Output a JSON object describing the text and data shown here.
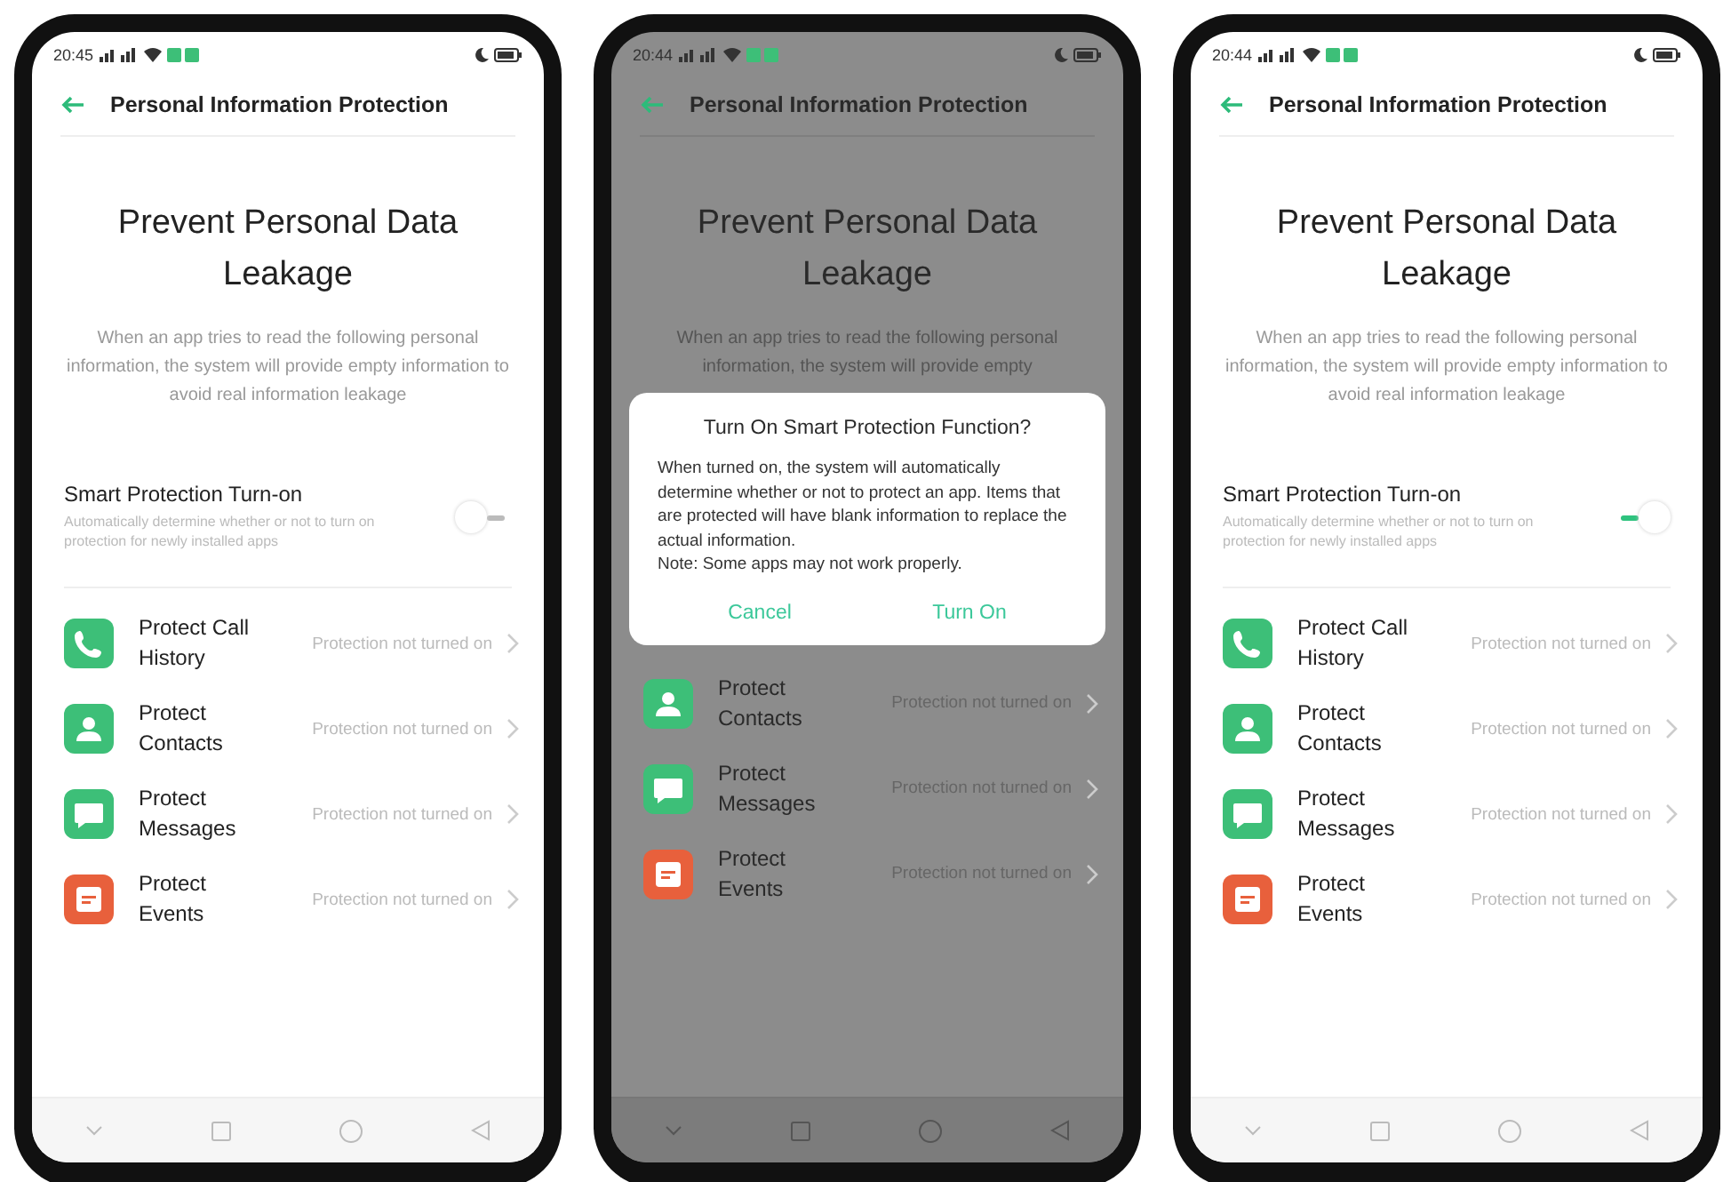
{
  "phones": [
    {
      "status": {
        "time": "20:45"
      },
      "header": {
        "title": "Personal Information Protection"
      },
      "heading": "Prevent Personal Data Leakage",
      "description": "When an app tries to read the following personal information, the system will provide empty information to avoid real information leakage",
      "smart": {
        "title": "Smart Protection Turn-on",
        "subtitle": "Automatically determine whether or not to turn on protection for newly installed apps",
        "on": false
      },
      "rows": [
        {
          "kind": "call",
          "title": "Protect Call History",
          "status": "Protection not turned on",
          "color": "#3dbf78"
        },
        {
          "kind": "contacts",
          "title": "Protect Contacts",
          "status": "Protection not turned on",
          "color": "#3dbf78"
        },
        {
          "kind": "messages",
          "title": "Protect Messages",
          "status": "Protection not turned on",
          "color": "#3dbf78"
        },
        {
          "kind": "events",
          "title": "Protect Events",
          "status": "Protection not turned on",
          "color": "#e8603c"
        }
      ]
    },
    {
      "status": {
        "time": "20:44"
      },
      "header": {
        "title": "Personal Information Protection"
      },
      "heading": "Prevent Personal Data Leakage",
      "description": "When an app tries to read the following personal information, the system will provide empty",
      "dialog": {
        "title": "Turn On Smart Protection Function?",
        "body": [
          "When turned on, the system will automatically determine whether or not to protect an app. Items that are protected will have blank information to replace the actual information.",
          "Note: Some apps may not work properly."
        ],
        "buttons": [
          "Cancel",
          "Turn On"
        ]
      },
      "rows": [
        {
          "kind": "contacts",
          "title": "Protect Contacts",
          "status": "Protection not turned on",
          "color": "#3dbf78"
        },
        {
          "kind": "messages",
          "title": "Protect Messages",
          "status": "Protection not turned on",
          "color": "#3dbf78"
        },
        {
          "kind": "events",
          "title": "Protect Events",
          "status": "Protection not turned on",
          "color": "#e8603c"
        }
      ]
    },
    {
      "status": {
        "time": "20:44"
      },
      "header": {
        "title": "Personal Information Protection"
      },
      "heading": "Prevent Personal Data Leakage",
      "description": "When an app tries to read the following personal information, the system will provide empty information to avoid real information leakage",
      "smart": {
        "title": "Smart Protection Turn-on",
        "subtitle": "Automatically determine whether or not to turn on protection for newly installed apps",
        "on": true
      },
      "rows": [
        {
          "kind": "call",
          "title": "Protect Call History",
          "status": "Protection not turned on",
          "color": "#3dbf78"
        },
        {
          "kind": "contacts",
          "title": "Protect Contacts",
          "status": "Protection not turned on",
          "color": "#3dbf78"
        },
        {
          "kind": "messages",
          "title": "Protect Messages",
          "status": "Protection not turned on",
          "color": "#3dbf78"
        },
        {
          "kind": "events",
          "title": "Protect Events",
          "status": "Protection not turned on",
          "color": "#e8603c"
        }
      ]
    }
  ]
}
